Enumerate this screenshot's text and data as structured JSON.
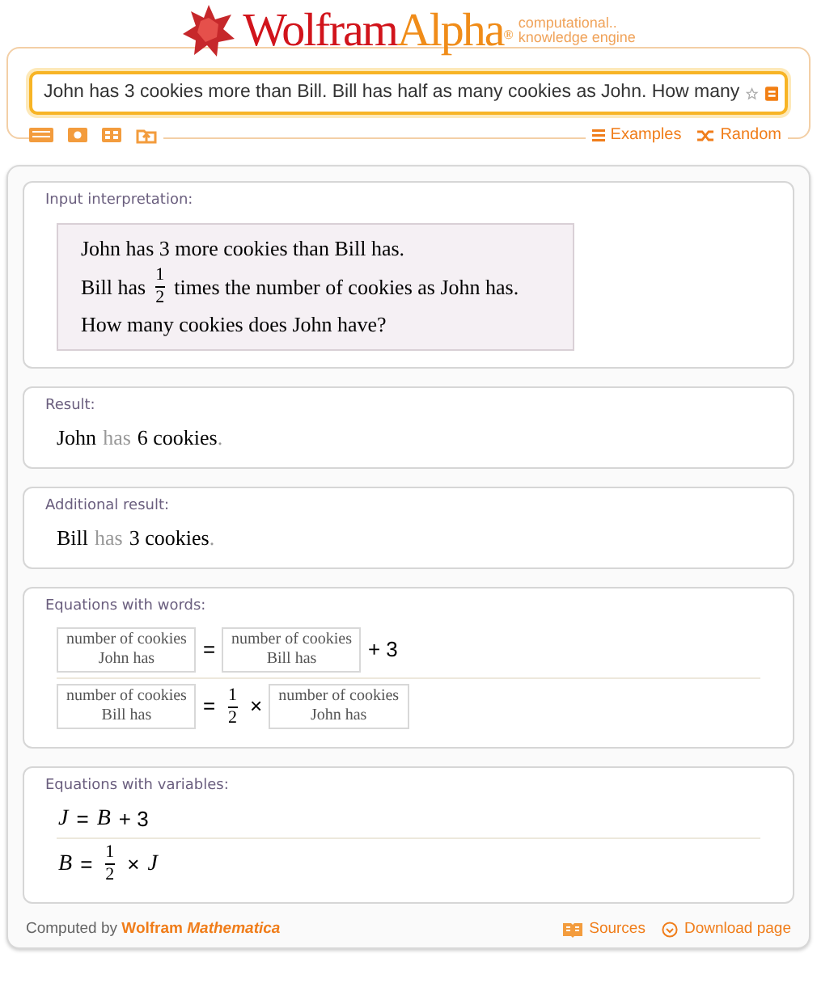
{
  "header": {
    "logo_primary": "Wolfram",
    "logo_secondary": "Alpha",
    "logo_mark": "®",
    "tagline": [
      "computational..",
      "knowledge engine"
    ]
  },
  "search": {
    "value": "John has 3 cookies more than Bill. Bill has half as many cookies as John. How many"
  },
  "links": [
    "Examples",
    "Random"
  ],
  "pods": [
    {
      "kind": "interpretation",
      "title": "Input interpretation:",
      "lines": [
        [
          {
            "kind": "text",
            "text": "John has 3 more cookies than Bill has."
          }
        ],
        [
          {
            "kind": "text",
            "text": "Bill has"
          },
          {
            "kind": "fraction",
            "numerator": "1",
            "denominator": "2"
          },
          {
            "kind": "text",
            "text": "times the number of cookies as John has."
          }
        ],
        [
          {
            "kind": "text",
            "text": "How many cookies does John have?"
          }
        ]
      ]
    },
    {
      "kind": "sentence",
      "title": "Result:",
      "parts": [
        {
          "text": "John",
          "muted": false
        },
        {
          "text": "has",
          "muted": true
        },
        {
          "text": "6 cookies",
          "muted": false
        },
        {
          "text": ".",
          "muted": true
        }
      ]
    },
    {
      "kind": "sentence",
      "title": "Additional result:",
      "parts": [
        {
          "text": "Bill",
          "muted": false
        },
        {
          "text": "has",
          "muted": true
        },
        {
          "text": "3 cookies",
          "muted": false
        },
        {
          "text": ".",
          "muted": true
        }
      ]
    },
    {
      "kind": "equations",
      "title": "Equations with words:",
      "equations": [
        [
          {
            "kind": "box",
            "top": "number of cookies",
            "bottom": "John has"
          },
          {
            "kind": "op",
            "text": "="
          },
          {
            "kind": "box",
            "top": "number of cookies",
            "bottom": "Bill has"
          },
          {
            "kind": "op",
            "text": "+ 3"
          }
        ],
        [
          {
            "kind": "box",
            "top": "number of cookies",
            "bottom": "Bill has"
          },
          {
            "kind": "op",
            "text": "="
          },
          {
            "kind": "fraction",
            "numerator": "1",
            "denominator": "2"
          },
          {
            "kind": "op",
            "text": "×"
          },
          {
            "kind": "box",
            "top": "number of cookies",
            "bottom": "John has"
          }
        ]
      ]
    },
    {
      "kind": "equations",
      "title": "Equations with variables:",
      "equations": [
        [
          {
            "kind": "var",
            "text": "J"
          },
          {
            "kind": "op",
            "text": "="
          },
          {
            "kind": "var",
            "text": "B"
          },
          {
            "kind": "op",
            "text": "+ 3"
          }
        ],
        [
          {
            "kind": "var",
            "text": "B"
          },
          {
            "kind": "op",
            "text": "="
          },
          {
            "kind": "fraction",
            "numerator": "1",
            "denominator": "2"
          },
          {
            "kind": "op",
            "text": "×"
          },
          {
            "kind": "var",
            "text": "J"
          }
        ]
      ]
    }
  ],
  "footer": {
    "computed_by": "Computed by",
    "brand": "Wolfram",
    "product": "Mathematica",
    "links": [
      "Sources",
      "Download page"
    ]
  }
}
